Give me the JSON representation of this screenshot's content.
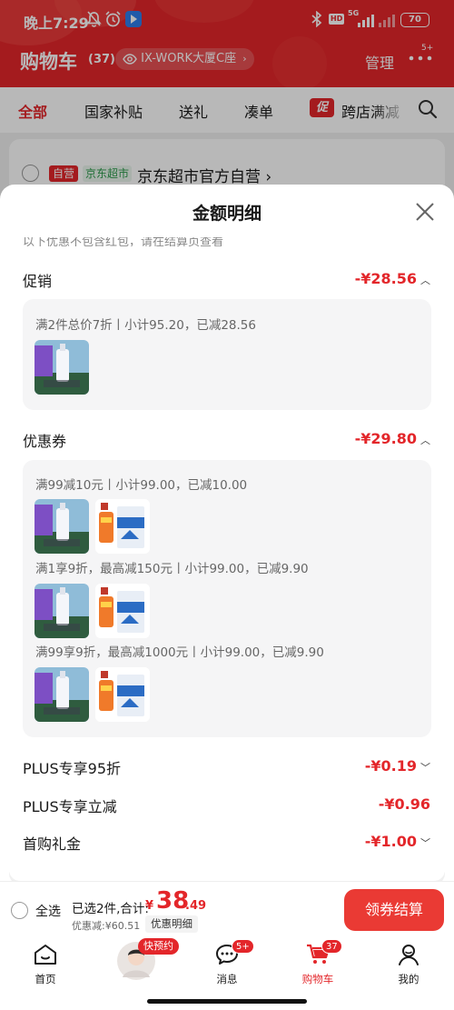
{
  "status_bar": {
    "time": "晚上7:29",
    "network": "5G",
    "hd": "HD",
    "battery": "70"
  },
  "header": {
    "title": "购物车",
    "count": "(37)",
    "address": "IX-WORK大厦C座",
    "manage": "管理",
    "more_badge": "5+"
  },
  "tabs": [
    {
      "label": "全部",
      "active": true
    },
    {
      "label": "国家补贴"
    },
    {
      "label": "送礼"
    },
    {
      "label": "凑单"
    },
    {
      "label": "跨店满减",
      "badge": "促"
    }
  ],
  "shop": {
    "self_tag": "自营",
    "market_tag": "京东超市",
    "name": "京东超市官方自营"
  },
  "sheet": {
    "title": "金额明细",
    "cut_note": "以下优惠不包含红包，请在结算页查看",
    "promo": {
      "label": "促销",
      "amount": "-¥28.56",
      "rule": "满2件总价7折丨小计95.20，已减28.56"
    },
    "coupon": {
      "label": "优惠券",
      "amount": "-¥29.80",
      "rules": [
        "满99减10元丨小计99.00，已减10.00",
        "满1享9折，最高减150元丨小计99.00，已减9.90",
        "满99享9折，最高减1000元丨小计99.00，已减9.90"
      ]
    },
    "plus_discount": {
      "label": "PLUS专享95折",
      "amount": "-¥0.19"
    },
    "plus_cut": {
      "label": "PLUS专享立减",
      "amount": "-¥0.96"
    },
    "first_gift": {
      "label": "首购礼金",
      "amount": "-¥1.00"
    }
  },
  "bottom": {
    "select_all": "全选",
    "selected": "已选2件,合计:",
    "currency": "¥",
    "total_int": "38",
    "total_dec": ".49",
    "saved": "优惠减:¥60.51",
    "detail": "优惠明细",
    "checkout": "领券结算"
  },
  "nav": {
    "home": "首页",
    "reserve_badge": "快预约",
    "messages": "消息",
    "messages_badge": "5+",
    "cart": "购物车",
    "cart_badge": "37",
    "mine": "我的"
  },
  "colors": {
    "brand_red": "#e3262a",
    "checkout_red": "#ea3a34",
    "overlay": "rgba(0,0,0,0.28)"
  }
}
